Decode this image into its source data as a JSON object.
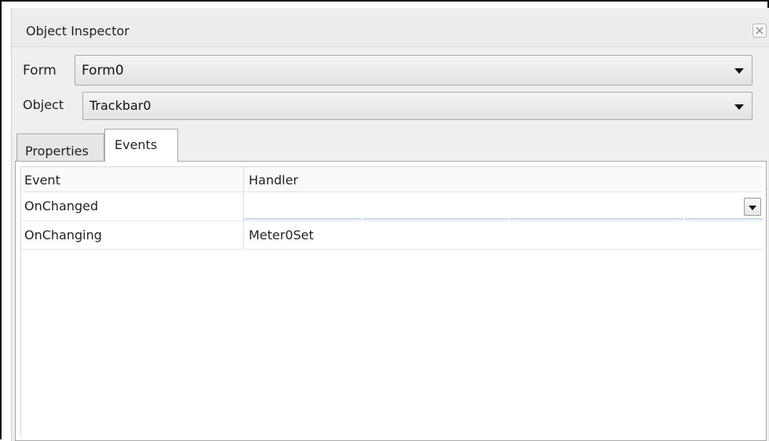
{
  "window": {
    "title": "Object Inspector",
    "close_icon": "close-icon"
  },
  "form_field": {
    "label": "Form",
    "value": "Form0"
  },
  "object_field": {
    "label": "Object",
    "value": "Trackbar0"
  },
  "tabs": [
    {
      "label": "Properties",
      "selected": false
    },
    {
      "label": "Events",
      "selected": true
    }
  ],
  "events_table": {
    "columns": [
      "Event",
      "Handler"
    ],
    "rows": [
      {
        "event": "OnChanged",
        "handler": ""
      },
      {
        "event": "OnChanging",
        "handler": "Meter0Set"
      }
    ]
  }
}
